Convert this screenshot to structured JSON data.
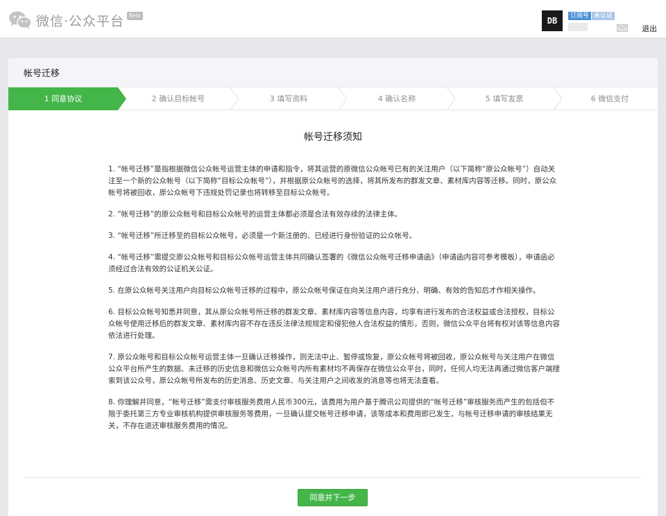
{
  "header": {
    "logo_text": "微信·公众平台",
    "beta_label": "Beta",
    "avatar_text": "DB",
    "account_type_badge": "订阅号",
    "auth_badge": "未认证",
    "logout_label": "退出"
  },
  "page": {
    "section_title": "帐号迁移",
    "doc_title": "帐号迁移须知",
    "next_button_label": "同意并下一步"
  },
  "steps": [
    {
      "label": "1 同意协议",
      "active": true
    },
    {
      "label": "2 确认目标帐号",
      "active": false
    },
    {
      "label": "3 填写资料",
      "active": false
    },
    {
      "label": "4 确认名称",
      "active": false
    },
    {
      "label": "5 填写发票",
      "active": false
    },
    {
      "label": "6 微信支付",
      "active": false
    }
  ],
  "doc": {
    "items": [
      "1. “帐号迁移”是指根据微信公众帐号运营主体的申请和指令，将其运营的原微信公众帐号已有的关注用户（以下简称“原公众帐号”）自动关注至一个新的公众帐号（以下简称“目标公众帐号”），并根据原公众帐号的选择，将其所发布的群发文章、素材库内容等迁移。同时，原公众帐号将被回收，原公众帐号下违规处罚记录也将转移至目标公众帐号。",
      "2. “帐号迁移”的原公众帐号和目标公众帐号的运营主体都必须是合法有效存续的法律主体。",
      "3. “帐号迁移”所迁移至的目标公众帐号，必须是一个新注册的、已经进行身份验证的公众帐号。",
      "4. “帐号迁移”需提交原公众帐号和目标公众帐号运营主体共同确认签署的《微信公众帐号迁移申请函》（申请函内容可参考模板），申请函必须经过合法有效的公证机关公证。",
      "5. 在原公众帐号关注用户向目标公众帐号迁移的过程中，原公众帐号保证在向关注用户进行充分、明确、有效的告知后才作相关操作。",
      "6. 目标公众帐号知悉并同意，其从原公众帐号所迁移的群发文章、素材库内容等信息内容，均享有进行发布的合法权益或合法授权，目标公众帐号使用迁移后的群发文章、素材库内容不存在违反法律法规规定和侵犯他人合法权益的情形，否则，微信公众平台将有权对该等信息内容依法进行处理。",
      "7. 原公众帐号和目标公众帐号运营主体一旦确认迁移操作，则无法中止、暂停或恢复，原公众帐号将被回收，原公众帐号与关注用户在微信公众平台所产生的数据、未迁移的历史信息和微信公众帐号内所有素材均不再保存在微信公众平台，同时，任何人均无法再通过微信客户端搜索到该公众号，原公众帐号所发布的历史消息、历史文章、与关注用户之间收发的消息等也将无法查看。",
      "8. 你理解并同意，“帐号迁移”需支付审核服务费用人民币300元，该费用为用户基于腾讯公司提供的“帐号迁移”审核服务而产生的包括但不限于委托第三方专业审核机构提供审核服务等费用，一旦确认提交帐号迁移申请，该等成本和费用即已发生，与帐号迁移申请的审核结果无关，不存在退还审核服务费用的情况。"
    ]
  },
  "colors": {
    "accent_green": "#44b549",
    "badge_blue": "#4a90d9",
    "badge_light_blue": "#a9c6e8"
  },
  "icons": {
    "logo": "wechat-logo-icon",
    "mail": "mail-icon"
  }
}
